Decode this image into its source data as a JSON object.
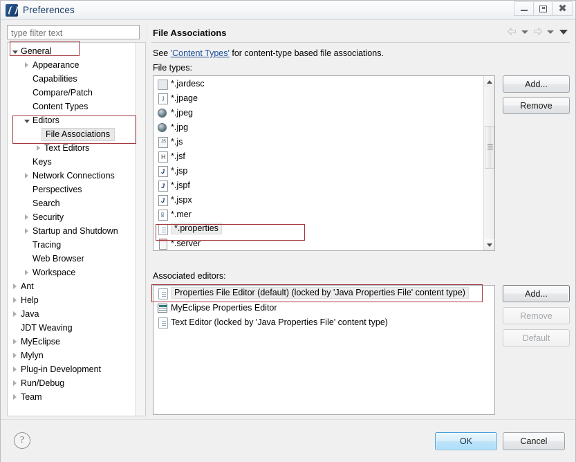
{
  "window": {
    "title": "Preferences",
    "icon": "eclipse-logo-icon",
    "buttons": {
      "minimize": "minimize-icon",
      "maximize": "restore-icon",
      "close": "close-icon"
    }
  },
  "sidebar": {
    "filter": {
      "placeholder": "type filter text",
      "value": ""
    },
    "items": [
      {
        "label": "General",
        "indent": 0,
        "expander": "expanded",
        "highlighted": true,
        "selected": false
      },
      {
        "label": "Appearance",
        "indent": 1,
        "expander": "collapsed",
        "highlighted": false,
        "selected": false
      },
      {
        "label": "Capabilities",
        "indent": 1,
        "expander": "none",
        "highlighted": false,
        "selected": false
      },
      {
        "label": "Compare/Patch",
        "indent": 1,
        "expander": "none",
        "highlighted": false,
        "selected": false
      },
      {
        "label": "Content Types",
        "indent": 1,
        "expander": "none",
        "highlighted": false,
        "selected": false
      },
      {
        "label": "Editors",
        "indent": 1,
        "expander": "expanded",
        "highlighted": false,
        "selected": false
      },
      {
        "label": "File Associations",
        "indent": 2,
        "expander": "none",
        "highlighted": false,
        "selected": true
      },
      {
        "label": "Text Editors",
        "indent": 2,
        "expander": "collapsed",
        "highlighted": false,
        "selected": false
      },
      {
        "label": "Keys",
        "indent": 1,
        "expander": "none",
        "highlighted": false,
        "selected": false
      },
      {
        "label": "Network Connections",
        "indent": 1,
        "expander": "collapsed",
        "highlighted": false,
        "selected": false
      },
      {
        "label": "Perspectives",
        "indent": 1,
        "expander": "none",
        "highlighted": false,
        "selected": false
      },
      {
        "label": "Search",
        "indent": 1,
        "expander": "none",
        "highlighted": false,
        "selected": false
      },
      {
        "label": "Security",
        "indent": 1,
        "expander": "collapsed",
        "highlighted": false,
        "selected": false
      },
      {
        "label": "Startup and Shutdown",
        "indent": 1,
        "expander": "collapsed",
        "highlighted": false,
        "selected": false
      },
      {
        "label": "Tracing",
        "indent": 1,
        "expander": "none",
        "highlighted": false,
        "selected": false
      },
      {
        "label": "Web Browser",
        "indent": 1,
        "expander": "none",
        "highlighted": false,
        "selected": false
      },
      {
        "label": "Workspace",
        "indent": 1,
        "expander": "collapsed",
        "highlighted": false,
        "selected": false
      },
      {
        "label": "Ant",
        "indent": 0,
        "expander": "collapsed",
        "highlighted": false,
        "selected": false
      },
      {
        "label": "Help",
        "indent": 0,
        "expander": "collapsed",
        "highlighted": false,
        "selected": false
      },
      {
        "label": "Java",
        "indent": 0,
        "expander": "collapsed",
        "highlighted": false,
        "selected": false
      },
      {
        "label": "JDT Weaving",
        "indent": 0,
        "expander": "none",
        "highlighted": false,
        "selected": false
      },
      {
        "label": "MyEclipse",
        "indent": 0,
        "expander": "collapsed",
        "highlighted": false,
        "selected": false
      },
      {
        "label": "Mylyn",
        "indent": 0,
        "expander": "collapsed",
        "highlighted": false,
        "selected": false
      },
      {
        "label": "Plug-in Development",
        "indent": 0,
        "expander": "collapsed",
        "highlighted": false,
        "selected": false
      },
      {
        "label": "Run/Debug",
        "indent": 0,
        "expander": "collapsed",
        "highlighted": false,
        "selected": false
      },
      {
        "label": "Team",
        "indent": 0,
        "expander": "collapsed",
        "highlighted": false,
        "selected": false
      }
    ]
  },
  "page": {
    "title": "File Associations",
    "description_prefix": "See ",
    "description_link": "'Content Types'",
    "description_suffix": " for content-type based file associations.",
    "file_types_label": "File types:",
    "associated_editors_label": "Associated editors:",
    "nav": {
      "back": "back-arrow-icon",
      "back_menu": "chevron-down-icon",
      "forward": "forward-arrow-icon",
      "forward_menu": "chevron-down-icon",
      "view_menu": "chevron-down-icon"
    }
  },
  "file_types": {
    "items": [
      {
        "label": "*.jardesc",
        "icon": "jar-descriptor-icon",
        "highlighted": false
      },
      {
        "label": "*.jpage",
        "icon": "java-page-icon",
        "highlighted": false
      },
      {
        "label": "*.jpeg",
        "icon": "image-file-icon",
        "highlighted": false
      },
      {
        "label": "*.jpg",
        "icon": "image-file-icon",
        "highlighted": false
      },
      {
        "label": "*.js",
        "icon": "javascript-file-icon",
        "highlighted": false
      },
      {
        "label": "*.jsf",
        "icon": "jsf-file-icon",
        "highlighted": false
      },
      {
        "label": "*.jsp",
        "icon": "jsp-file-icon",
        "highlighted": false
      },
      {
        "label": "*.jspf",
        "icon": "jsp-file-icon",
        "highlighted": false
      },
      {
        "label": "*.jspx",
        "icon": "jsp-file-icon",
        "highlighted": false
      },
      {
        "label": "*.mer",
        "icon": "mer-file-icon",
        "highlighted": false
      },
      {
        "label": "*.properties",
        "icon": "properties-file-icon",
        "highlighted": true
      },
      {
        "label": "*.server",
        "icon": "server-file-icon",
        "highlighted": false
      }
    ],
    "add_label": "Add...",
    "remove_label": "Remove"
  },
  "associated_editors": {
    "items": [
      {
        "label": "Properties File Editor (default) (locked by 'Java Properties File' content type)",
        "icon": "text-document-icon",
        "highlighted": true
      },
      {
        "label": "MyEclipse Properties Editor",
        "icon": "table-editor-icon",
        "highlighted": false
      },
      {
        "label": "Text Editor (locked by 'Java Properties File' content type)",
        "icon": "text-document-icon",
        "highlighted": false
      }
    ],
    "add_label": "Add...",
    "remove_label": "Remove",
    "default_label": "Default"
  },
  "footer": {
    "help_label": "?",
    "ok_label": "OK",
    "cancel_label": "Cancel"
  },
  "colors": {
    "annotation": "#a33a3f",
    "link": "#1b4f9c",
    "ok_accent": "#3f9ad6",
    "title_text": "#1b3c66"
  }
}
